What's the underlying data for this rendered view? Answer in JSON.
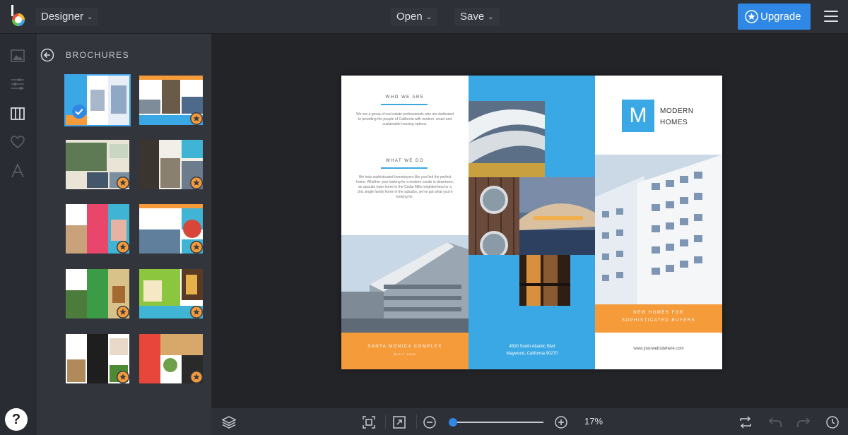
{
  "header": {
    "logo_icon": "befunky-b-logo-icon",
    "mode_label": "Designer",
    "open_label": "Open",
    "save_label": "Save",
    "upgrade_label": "Upgrade",
    "upgrade_icon": "star-badge-icon",
    "menu_icon": "hamburger-menu-icon",
    "accent_color": "#2f88e6"
  },
  "rail": {
    "icons": [
      "image-icon",
      "sliders-icon",
      "layout-columns-icon",
      "heart-icon",
      "text-icon"
    ],
    "help_label": "?"
  },
  "panel": {
    "back_icon": "back-arrow-icon",
    "title": "BROCHURES",
    "templates": [
      {
        "selected": true,
        "premium": false
      },
      {
        "selected": false,
        "premium": true
      },
      {
        "selected": false,
        "premium": true
      },
      {
        "selected": false,
        "premium": true
      },
      {
        "selected": false,
        "premium": true
      },
      {
        "selected": false,
        "premium": true
      },
      {
        "selected": false,
        "premium": true
      },
      {
        "selected": false,
        "premium": true
      },
      {
        "selected": false,
        "premium": true
      },
      {
        "selected": false,
        "premium": true
      }
    ],
    "premium_color": "#f59b3a"
  },
  "document": {
    "who_heading": "WHO WE ARE",
    "who_body": "We are a group of real estate professionals who are dedicated to providing the people of California with modern, smart and sustainable housing options.",
    "what_heading": "WHAT WE DO",
    "what_body": "We help sophisticated homebuyers like you find the perfect home. Whether your looking for a modern condo in downtown, an upscale town home in the Cedar Mills neighborhood or a chic single family home in the suburbs, we've got what you're looking for.",
    "band_left_title": "SANTA MONICA COMPLEX",
    "band_left_sub": "BUILT 2016",
    "address_line1": "4500 South Atlantic Blvd",
    "address_line2": "Maywood, California 90270",
    "logo_letter": "M",
    "logo_line1": "MODERN",
    "logo_line2": "HOMES",
    "band_right_line1": "NEW HOMES FOR",
    "band_right_line2": "SOPHISTICATED BUYERS",
    "website": "www.yourwebsitehere.com",
    "blue": "#3aa8e4",
    "orange": "#f59b3a"
  },
  "bottombar": {
    "layers_icon": "layers-icon",
    "fit_icon": "fit-screen-icon",
    "expand_icon": "expand-arrow-icon",
    "zoom_out_icon": "zoom-out-minus-icon",
    "zoom_in_icon": "zoom-in-plus-icon",
    "zoom_level": "17%",
    "zoom_fraction": 0.03,
    "replace_icon": "swap-icon",
    "undo_icon": "undo-icon",
    "redo_icon": "redo-icon",
    "history_icon": "history-clock-icon"
  }
}
